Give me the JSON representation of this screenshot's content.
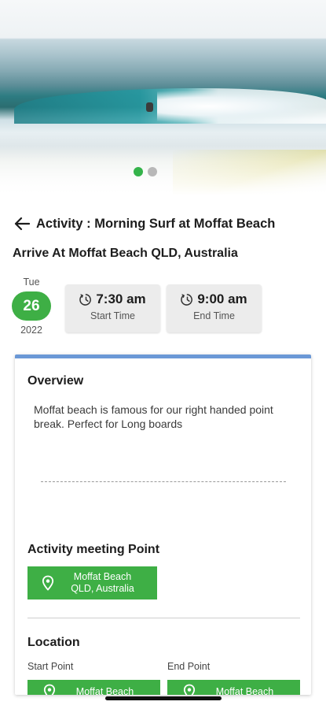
{
  "carousel": {
    "slide_count": 2,
    "active_index": 0,
    "active_color": "#34b34a",
    "inactive_color": "#b8b8b8"
  },
  "header": {
    "title": "Activity : Morning Surf at Moffat Beach",
    "back_icon": "arrow-left-icon"
  },
  "arrive_text": "Arrive At Moffat Beach QLD, Australia",
  "date": {
    "weekday": "Tue",
    "day": "26",
    "year": "2022",
    "badge_color": "#3eaf45"
  },
  "start_time": {
    "value": "7:30 am",
    "label": "Start Time",
    "icon": "clock-icon"
  },
  "end_time": {
    "value": "9:00 am",
    "label": "End Time",
    "icon": "clock-icon"
  },
  "overview": {
    "title": "Overview",
    "text": "Moffat beach is famous for our right handed point break. Perfect for Long boards"
  },
  "meeting_point": {
    "title": "Activity meeting Point",
    "button_label": "Moffat Beach\nQLD, Australia",
    "line1": "Moffat Beach",
    "line2": "QLD, Australia",
    "icon": "location-pin-icon"
  },
  "location": {
    "title": "Location",
    "start_label": "Start Point",
    "end_label": "End Point",
    "start_value": "Moffat Beach",
    "end_value": "Moffat Beach",
    "icon": "location-pin-icon"
  },
  "colors": {
    "accent_green": "#3eaf45",
    "card_top_border": "#6b98d6"
  }
}
